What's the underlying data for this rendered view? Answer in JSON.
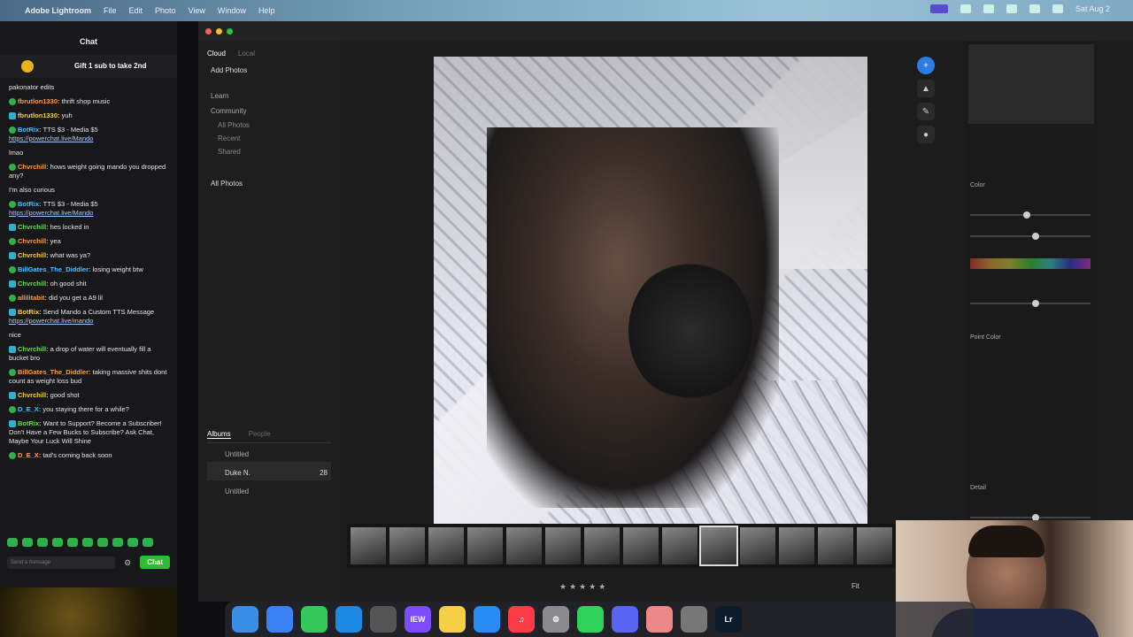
{
  "menubar": {
    "app": "Adobe Lightroom",
    "items": [
      "File",
      "Edit",
      "Photo",
      "View",
      "Window",
      "Help"
    ],
    "clock": "Sat Aug 2"
  },
  "chat": {
    "title": "Chat",
    "gift_text": "Gift 1 sub to take 2nd",
    "messages": [
      {
        "user": "",
        "text": "pakonator edits"
      },
      {
        "user": "fbrutlon1330:",
        "text": " thrift shop music"
      },
      {
        "user": "fbrutlon1330:",
        "text": " yuh"
      },
      {
        "user": "BotRix:",
        "text": " TTS $3 - Media $5",
        "link": "https://powerchat.live/Mando"
      },
      {
        "user": "",
        "text": "lmao"
      },
      {
        "user": "Chvrchill:",
        "text": " hows weight going mando you dropped any?"
      },
      {
        "user": "",
        "text": " I'm also curious"
      },
      {
        "user": "BotRix:",
        "text": " TTS $3 - Media $5",
        "link": "https://powerchat.live/Mando"
      },
      {
        "user": "Chvrchill:",
        "text": " hes locked in"
      },
      {
        "user": "Chvrchill:",
        "text": " yea"
      },
      {
        "user": "Chvrchill:",
        "text": " what was ya?"
      },
      {
        "user": "BillGates_The_Diddler:",
        "text": " losing weight btw"
      },
      {
        "user": "Chvrchill:",
        "text": " oh good shit"
      },
      {
        "user": "allilitabit:",
        "text": " did you get a A9 lil"
      },
      {
        "user": "BotRix:",
        "text": " Send Mando a Custom TTS Message ",
        "link": "https://powerchat.live/mando"
      },
      {
        "user": "",
        "text": "nice"
      },
      {
        "user": "Chvrchill:",
        "text": " a drop of water will eventually fill a bucket bro"
      },
      {
        "user": "BillGates_The_Diddler:",
        "text": " taking massive shits dont count as weight loss bud"
      },
      {
        "user": "Chvrchill:",
        "text": " good shot"
      },
      {
        "user": "D_E_X:",
        "text": " you staying there for a while?"
      },
      {
        "user": "BotRix:",
        "text": " Want to Support? Become a Subscriber! Don't Have a Few Bucks to Subscribe? Ask Chat, Maybe Your Luck Will Shine"
      },
      {
        "user": "D_E_X:",
        "text": " tad's coming back soon"
      }
    ],
    "input_placeholder": "Send a message",
    "send_label": "Chat"
  },
  "lightroom": {
    "left_tabs": [
      "Cloud",
      "Local"
    ],
    "add_photos": "Add Photos",
    "nav": [
      "Learn",
      "Community"
    ],
    "nav_sub": [
      "All Photos",
      "Recent",
      "Shared"
    ],
    "section": "All Photos",
    "albums_tab": "Albums",
    "albums_tab2": "People",
    "albums": [
      {
        "name": "Untitled",
        "count": ""
      },
      {
        "name": "Duke N.",
        "count": "28"
      },
      {
        "name": "Untitled",
        "count": ""
      }
    ],
    "right_labels": [
      "Color",
      "Point Color",
      "Detail"
    ],
    "fit_label": "Fit",
    "stars": "★★★★★"
  },
  "dock": {
    "items": [
      {
        "name": "finder-icon",
        "label": "",
        "color": "#3a8ee6"
      },
      {
        "name": "mail-icon",
        "label": "",
        "color": "#3b82f6"
      },
      {
        "name": "messages-icon",
        "label": "",
        "color": "#34c759"
      },
      {
        "name": "safari-icon",
        "label": "",
        "color": "#1e88e5"
      },
      {
        "name": "chrome-icon",
        "label": "",
        "color": "#555"
      },
      {
        "name": "news-icon",
        "label": "IEW",
        "color": "#7c4dff"
      },
      {
        "name": "notes-icon",
        "label": "",
        "color": "#f5d046"
      },
      {
        "name": "appstore-icon",
        "label": "",
        "color": "#2a8af6"
      },
      {
        "name": "music-icon",
        "label": "♫",
        "color": "#fc3c44"
      },
      {
        "name": "settings-icon",
        "label": "⚙",
        "color": "#8a8a8e"
      },
      {
        "name": "facetime-icon",
        "label": "",
        "color": "#30d158"
      },
      {
        "name": "discord-icon",
        "label": "",
        "color": "#5865f2"
      },
      {
        "name": "photos-icon",
        "label": "",
        "color": "#e88"
      },
      {
        "name": "preview-icon",
        "label": "",
        "color": "#777"
      },
      {
        "name": "lightroom-icon",
        "label": "Lr",
        "color": "#0b1b2a"
      }
    ]
  }
}
